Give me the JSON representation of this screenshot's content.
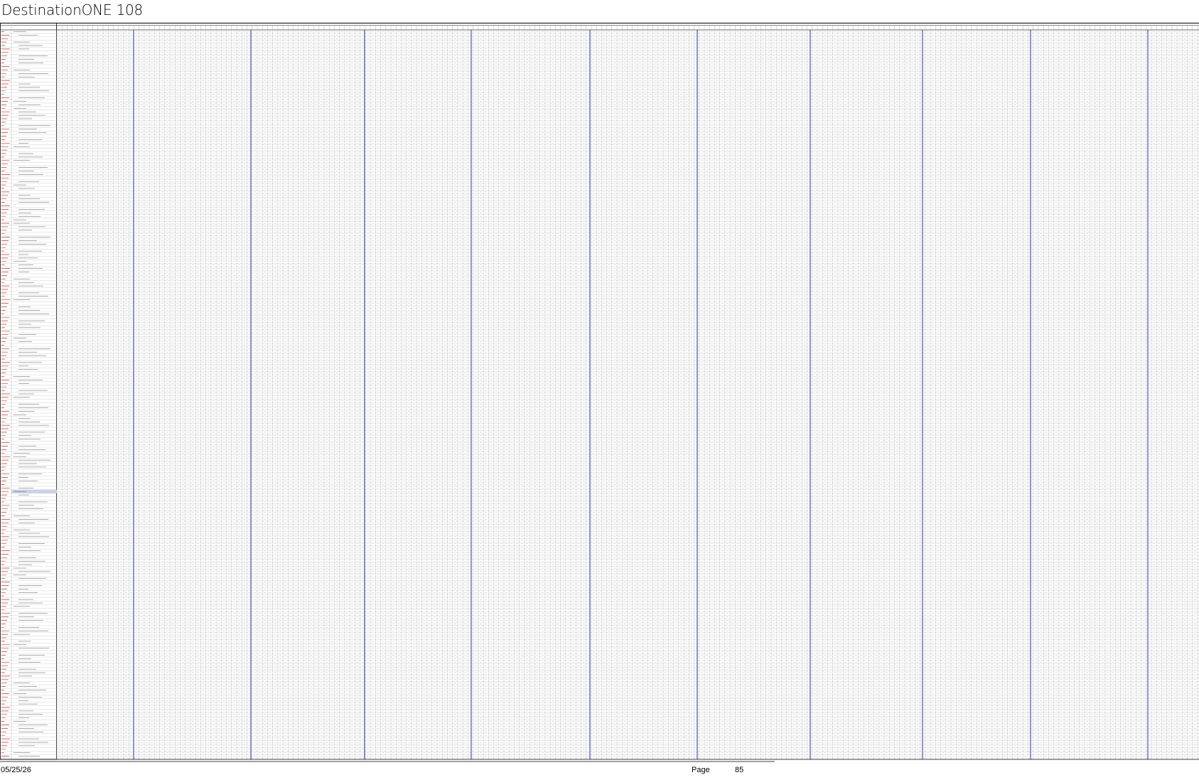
{
  "document": {
    "title": "DestinationONE 108"
  },
  "footer": {
    "date": "05/25/26",
    "page_label": "Page",
    "page_number": "85"
  },
  "colors": {
    "grid_line": "#bdbdbd",
    "cell_border": "#9e9e9e",
    "group_divider": "#2b3a9e",
    "header_line": "#000000",
    "placeholder_text": "#8a8a8a",
    "row_code_accent": "#c0392b",
    "highlight_row": "#c9d3ee"
  }
}
